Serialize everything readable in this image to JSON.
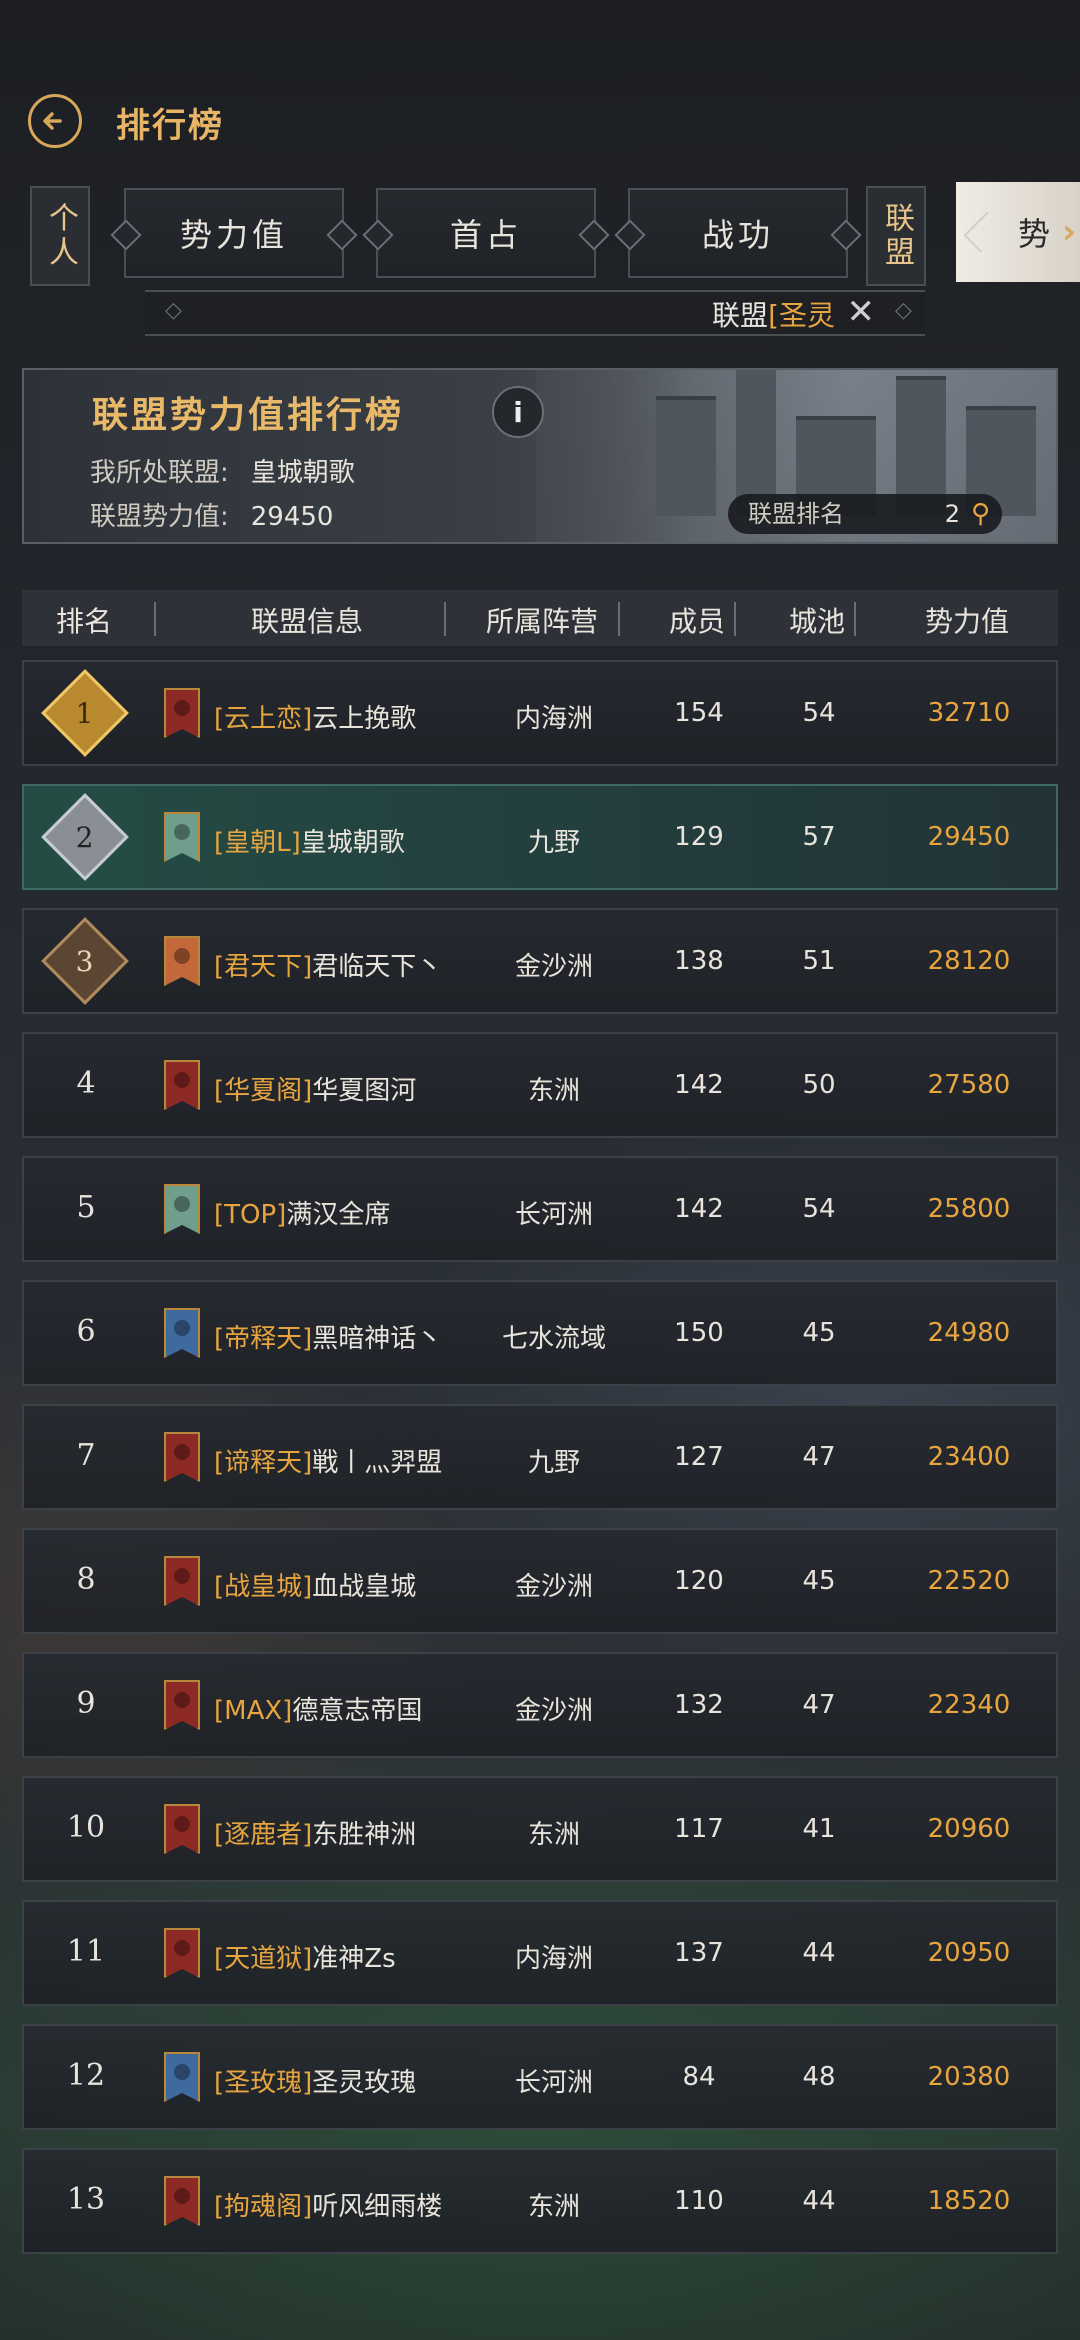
{
  "header": {
    "title": "排行榜"
  },
  "tabs": {
    "personal": "个人",
    "alliance": "联盟",
    "items": [
      "势力值",
      "首占",
      "战功"
    ],
    "active": "势"
  },
  "subbar": {
    "label": "联盟",
    "alliance_tag": "[圣灵"
  },
  "banner": {
    "title": "联盟势力值排行榜",
    "my_alliance_label": "我所处联盟:",
    "my_alliance_value": "皇城朝歌",
    "power_label": "联盟势力值:",
    "power_value": "29450",
    "rank_label": "联盟排名",
    "rank_value": "2"
  },
  "table": {
    "columns": [
      "排名",
      "联盟信息",
      "所属阵营",
      "成员",
      "城池",
      "势力值"
    ],
    "rows": [
      {
        "rank": "1",
        "tag": "[云上恋]",
        "name": "云上挽歌",
        "camp": "内海洲",
        "members": "154",
        "cities": "54",
        "power": "32710",
        "flag": "red"
      },
      {
        "rank": "2",
        "tag": "[皇朝L]",
        "name": "皇城朝歌",
        "camp": "九野",
        "members": "129",
        "cities": "57",
        "power": "29450",
        "flag": "teal"
      },
      {
        "rank": "3",
        "tag": "[君天下]",
        "name": "君临天下丶",
        "camp": "金沙洲",
        "members": "138",
        "cities": "51",
        "power": "28120",
        "flag": "orange"
      },
      {
        "rank": "4",
        "tag": "[华夏阁]",
        "name": "华夏图河",
        "camp": "东洲",
        "members": "142",
        "cities": "50",
        "power": "27580",
        "flag": "red"
      },
      {
        "rank": "5",
        "tag": "[TOP]",
        "name": "满汉全席",
        "camp": "长河洲",
        "members": "142",
        "cities": "54",
        "power": "25800",
        "flag": "teal"
      },
      {
        "rank": "6",
        "tag": "[帝释天]",
        "name": "黑暗神话丶",
        "camp": "七水流域",
        "members": "150",
        "cities": "45",
        "power": "24980",
        "flag": "blue"
      },
      {
        "rank": "7",
        "tag": "[谛释天]",
        "name": "戦丨灬羿盟",
        "camp": "九野",
        "members": "127",
        "cities": "47",
        "power": "23400",
        "flag": "red"
      },
      {
        "rank": "8",
        "tag": "[战皇城]",
        "name": "血战皇城",
        "camp": "金沙洲",
        "members": "120",
        "cities": "45",
        "power": "22520",
        "flag": "red"
      },
      {
        "rank": "9",
        "tag": "[MAX]",
        "name": "德意志帝国",
        "camp": "金沙洲",
        "members": "132",
        "cities": "47",
        "power": "22340",
        "flag": "red"
      },
      {
        "rank": "10",
        "tag": "[逐鹿者]",
        "name": "东胜神洲",
        "camp": "东洲",
        "members": "117",
        "cities": "41",
        "power": "20960",
        "flag": "red"
      },
      {
        "rank": "11",
        "tag": "[天道狱]",
        "name": "准神Zs",
        "camp": "内海洲",
        "members": "137",
        "cities": "44",
        "power": "20950",
        "flag": "red"
      },
      {
        "rank": "12",
        "tag": "[圣玫瑰]",
        "name": "圣灵玫瑰",
        "camp": "长河洲",
        "members": "84",
        "cities": "48",
        "power": "20380",
        "flag": "blue"
      },
      {
        "rank": "13",
        "tag": "[拘魂阁]",
        "name": "听风细雨楼",
        "camp": "东洲",
        "members": "110",
        "cities": "44",
        "power": "18520",
        "flag": "red"
      }
    ]
  },
  "colors": {
    "accent": "#e7a540",
    "title_gold": "#e9b96a",
    "highlight_row": "#244e46"
  },
  "icons": {
    "back": "back-arrow-icon",
    "info": "info-icon",
    "search": "search-icon",
    "close": "crossed-swords-icon"
  }
}
